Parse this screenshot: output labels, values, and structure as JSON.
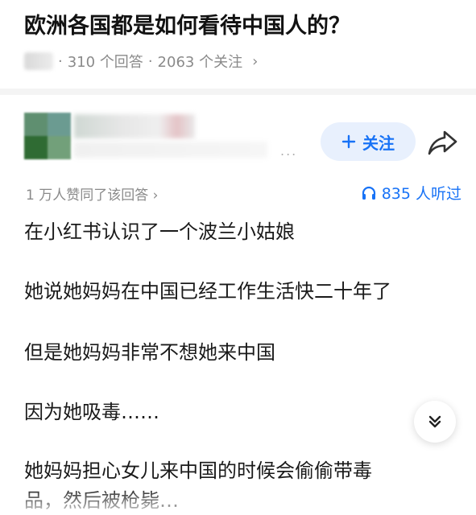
{
  "question": {
    "title": "欧洲各国都是如何看待中国人的？",
    "answers_count": "310 个回答",
    "followers_count": "2063 个关注",
    "separator": "·"
  },
  "author": {
    "follow_label": "关注",
    "more": "..."
  },
  "answer": {
    "likes_text": "1 万人赞同了该回答 ›",
    "listen_count": "835 人听过",
    "paragraphs": [
      "在小红书认识了一个波兰小姑娘",
      "她说她妈妈在中国已经工作生活快二十年了",
      "但是她妈妈非常不想她来中国",
      "因为她吸毒……",
      "她妈妈担心女儿来中国的时候会偷偷带毒",
      "品，然后被枪毙…"
    ]
  },
  "icons": {
    "share": "share-icon",
    "headphone": "headphone-icon",
    "expand": "chevron-double-down-icon",
    "plus": "plus-icon"
  },
  "colors": {
    "accent": "#1772f6",
    "follow_bg": "#e8f0fd",
    "muted": "#8a8a8a"
  }
}
